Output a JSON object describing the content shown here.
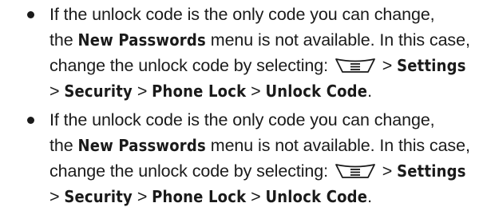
{
  "items": [
    {
      "line1": "If the unlock code is the only code you can change,",
      "line2_pre": "the ",
      "line2_bold": "New Passwords",
      "line2_post": " menu is not available. In this case,",
      "line3_pre": "change the unlock code by selecting: ",
      "line3_sep": " > ",
      "line3_bold": "Settings",
      "line4_sep1": "> ",
      "line4_bold1": "Security",
      "line4_sep2": " > ",
      "line4_bold2": "Phone Lock",
      "line4_sep3": " > ",
      "line4_bold3": "Unlock Code",
      "line4_end": ".",
      "icon": "menu-key-icon"
    },
    {
      "line1": "If the unlock code is the only code you can change,",
      "line2_pre": "the ",
      "line2_bold": "New Passwords",
      "line2_post": " menu is not available. In this case,",
      "line3_pre": "change the unlock code by selecting: ",
      "line3_sep": " > ",
      "line3_bold": "Settings",
      "line4_sep1": "> ",
      "line4_bold1": "Security",
      "line4_sep2": " > ",
      "line4_bold2": "Phone Lock",
      "line4_sep3": " > ",
      "line4_bold3": "Unlock Code",
      "line4_end": ".",
      "icon": "menu-key-icon"
    }
  ]
}
